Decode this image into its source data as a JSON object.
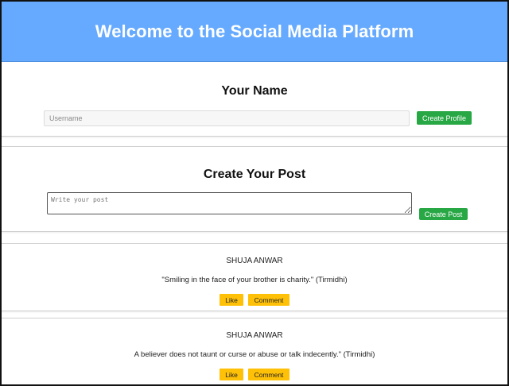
{
  "header": {
    "title": "Welcome to the Social Media Platform"
  },
  "profile": {
    "title": "Your Name",
    "username_placeholder": "Username",
    "username_value": "",
    "create_button": "Create Profile"
  },
  "post_form": {
    "title": "Create Your Post",
    "post_placeholder": "Write your post",
    "post_value": "",
    "create_button": "Create Post"
  },
  "posts": [
    {
      "author": "SHUJA ANWAR",
      "content": "\"Smiling in the face of your brother is charity.\" (Tirmidhi)",
      "like_label": "Like",
      "comment_label": "Comment"
    },
    {
      "author": "SHUJA ANWAR",
      "content": "A believer does not taunt or curse or abuse or talk indecently.\" (Tirmidhi)",
      "like_label": "Like",
      "comment_label": "Comment"
    }
  ],
  "colors": {
    "header_bg": "#66aaff",
    "primary_button": "#28a745",
    "secondary_button": "#ffc107"
  }
}
